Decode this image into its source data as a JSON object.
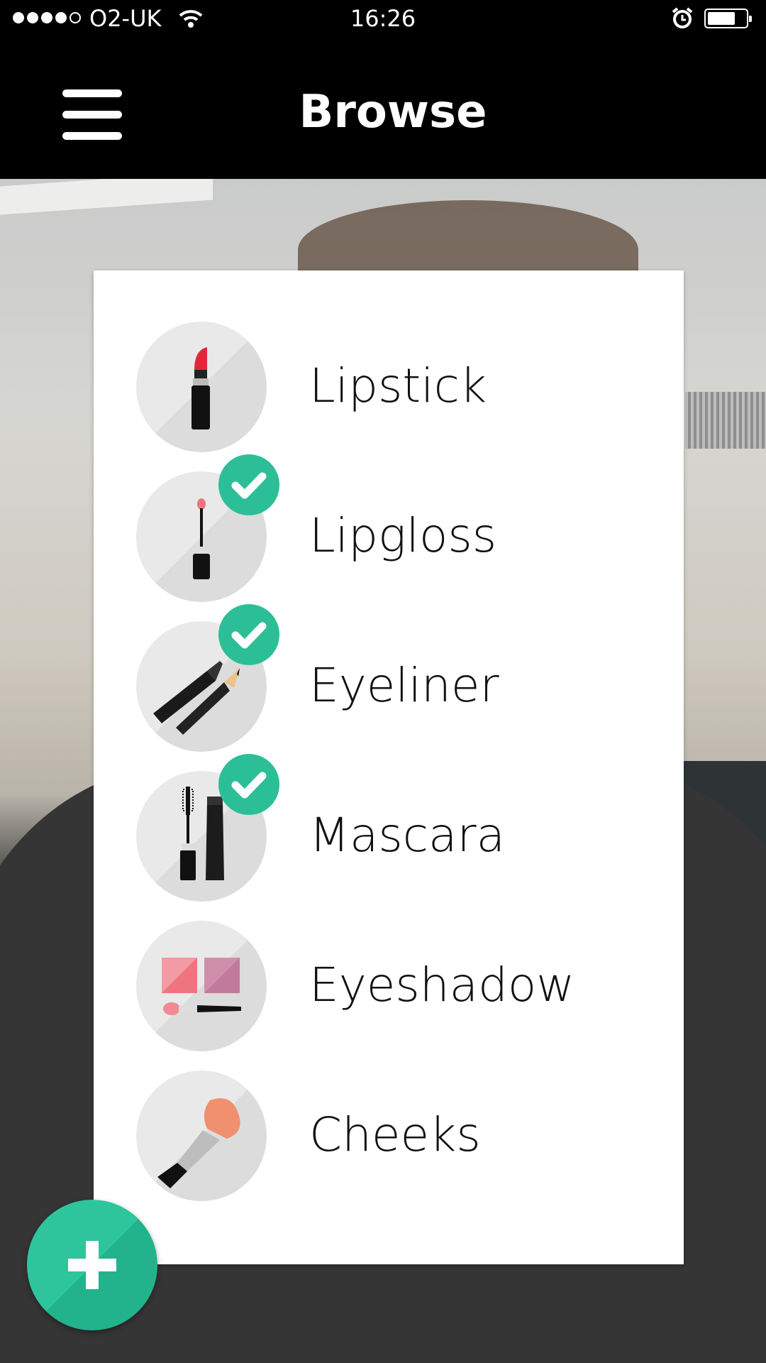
{
  "status_bar": {
    "carrier": "O2-UK",
    "time": "16:26",
    "signal_bars_filled": 4,
    "signal_bars_total": 5,
    "battery_level": 0.7
  },
  "nav": {
    "title": "Browse",
    "menu_icon": "hamburger-menu-icon"
  },
  "categories": [
    {
      "label": "Lipstick",
      "icon": "lipstick-icon",
      "selected": false
    },
    {
      "label": "Lipgloss",
      "icon": "lipgloss-icon",
      "selected": true
    },
    {
      "label": "Eyeliner",
      "icon": "eyeliner-icon",
      "selected": true
    },
    {
      "label": "Mascara",
      "icon": "mascara-icon",
      "selected": true
    },
    {
      "label": "Eyeshadow",
      "icon": "eyeshadow-icon",
      "selected": false
    },
    {
      "label": "Cheeks",
      "icon": "cheeks-brush-icon",
      "selected": false
    }
  ],
  "colors": {
    "accent": "#2cbf97",
    "lipstick": "#e0283a",
    "eyeshadow_pink": "#ef7480",
    "eyeshadow_mauve": "#c27a9a",
    "blush": "#f0906e"
  },
  "fab": {
    "icon": "plus-icon"
  }
}
